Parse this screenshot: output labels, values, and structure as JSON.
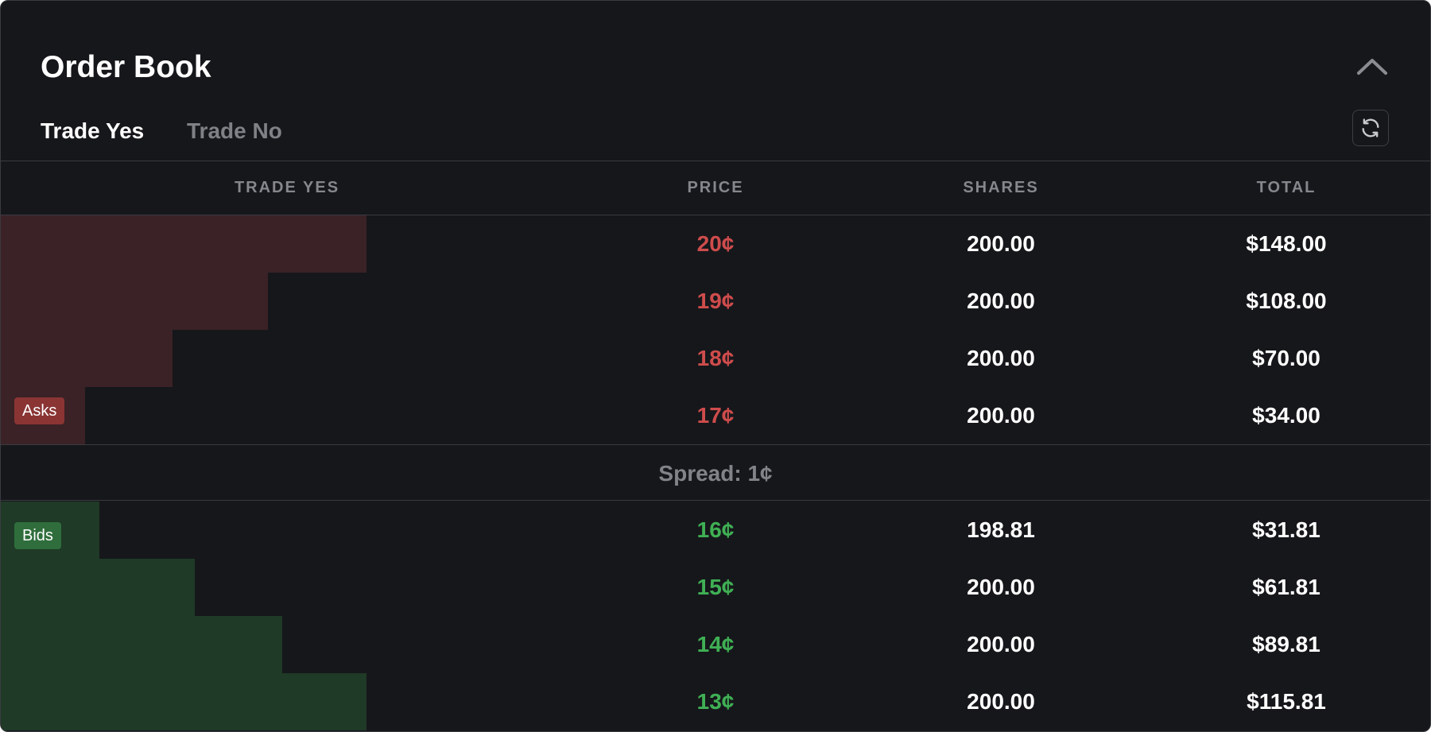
{
  "title": "Order Book",
  "tabs": [
    {
      "label": "Trade Yes",
      "active": true
    },
    {
      "label": "Trade No",
      "active": false
    }
  ],
  "icons": {
    "collapse": "chevron-up-icon",
    "refresh": "refresh-icon"
  },
  "columns": [
    "TRADE YES",
    "PRICE",
    "SHARES",
    "TOTAL"
  ],
  "asks_label": "Asks",
  "bids_label": "Bids",
  "spread": "Spread: 1¢",
  "colors": {
    "ask": "#cf4c4c",
    "bid": "#3fb054",
    "ask_bar": "#3a2226",
    "bid_bar": "#1f3a27"
  },
  "asks": [
    {
      "price": "20¢",
      "shares": "200.00",
      "total": "$148.00",
      "depth_pct": 100
    },
    {
      "price": "19¢",
      "shares": "200.00",
      "total": "$108.00",
      "depth_pct": 73
    },
    {
      "price": "18¢",
      "shares": "200.00",
      "total": "$70.00",
      "depth_pct": 47
    },
    {
      "price": "17¢",
      "shares": "200.00",
      "total": "$34.00",
      "depth_pct": 23
    }
  ],
  "bids": [
    {
      "price": "16¢",
      "shares": "198.81",
      "total": "$31.81",
      "depth_pct": 27
    },
    {
      "price": "15¢",
      "shares": "200.00",
      "total": "$61.81",
      "depth_pct": 53
    },
    {
      "price": "14¢",
      "shares": "200.00",
      "total": "$89.81",
      "depth_pct": 77
    },
    {
      "price": "13¢",
      "shares": "200.00",
      "total": "$115.81",
      "depth_pct": 100
    }
  ]
}
